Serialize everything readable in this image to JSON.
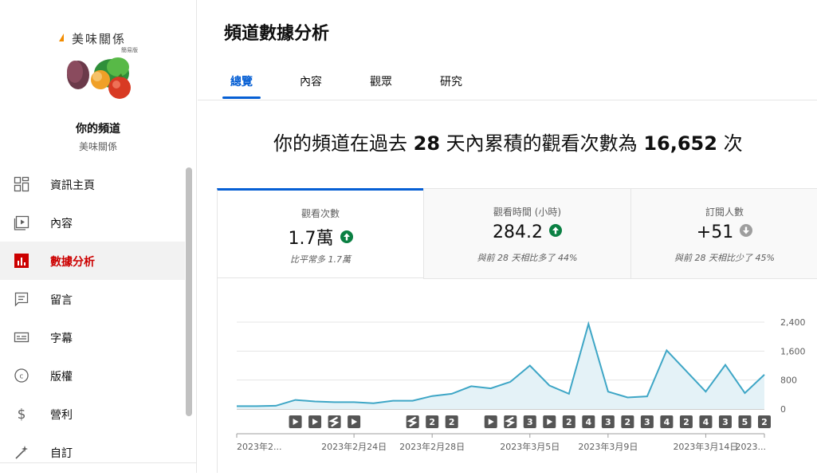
{
  "sidebar": {
    "logo_text": "美味關係",
    "logo_sub": "簡易版",
    "channel_title": "你的頻道",
    "channel_name": "美味關係",
    "items": [
      {
        "label": "資訊主頁",
        "icon": "dashboard-icon"
      },
      {
        "label": "內容",
        "icon": "content-icon"
      },
      {
        "label": "數據分析",
        "icon": "analytics-icon",
        "active": true
      },
      {
        "label": "留言",
        "icon": "comments-icon"
      },
      {
        "label": "字幕",
        "icon": "subtitles-icon"
      },
      {
        "label": "版權",
        "icon": "copyright-icon"
      },
      {
        "label": "營利",
        "icon": "monetization-icon"
      },
      {
        "label": "自訂",
        "icon": "customization-icon"
      }
    ]
  },
  "main": {
    "title": "頻道數據分析",
    "tabs": [
      {
        "label": "總覽",
        "active": true
      },
      {
        "label": "內容"
      },
      {
        "label": "觀眾"
      },
      {
        "label": "研究"
      }
    ],
    "headline": {
      "prefix": "你的頻道在過去 ",
      "days": "28",
      "middle": " 天內累積的觀看次數為 ",
      "views": "16,652",
      "suffix": " 次"
    },
    "cards": [
      {
        "label": "觀看次數",
        "value": "1.7萬",
        "trend": "up",
        "sub": "比平常多 1.7萬"
      },
      {
        "label": "觀看時間 (小時)",
        "value": "284.2",
        "trend": "up",
        "sub": "與前 28 天相比多了 44%"
      },
      {
        "label": "訂閱人數",
        "value": "+51",
        "trend": "down",
        "sub": "與前 28 天相比少了 45%"
      }
    ]
  },
  "colors": {
    "accent": "#065fd4",
    "active_nav": "#cc0000",
    "trend_up": "#0b8043",
    "trend_down": "#9e9e9e",
    "chart_line": "#3ea6c6",
    "chart_fill": "#e4f2f7"
  },
  "chart_data": {
    "type": "area",
    "x": [
      "2023-02-18",
      "2023-02-19",
      "2023-02-20",
      "2023-02-21",
      "2023-02-22",
      "2023-02-23",
      "2023-02-24",
      "2023-02-25",
      "2023-02-26",
      "2023-02-27",
      "2023-02-28",
      "2023-03-01",
      "2023-03-02",
      "2023-03-03",
      "2023-03-04",
      "2023-03-05",
      "2023-03-06",
      "2023-03-07",
      "2023-03-08",
      "2023-03-09",
      "2023-03-10",
      "2023-03-11",
      "2023-03-12",
      "2023-03-13",
      "2023-03-14",
      "2023-03-15",
      "2023-03-16",
      "2023-03-17"
    ],
    "values": [
      80,
      80,
      90,
      250,
      210,
      190,
      190,
      160,
      230,
      230,
      360,
      420,
      630,
      570,
      750,
      1200,
      650,
      420,
      2350,
      480,
      320,
      350,
      1620,
      1050,
      480,
      1220,
      440,
      950
    ],
    "y_ticks": [
      "2,400",
      "1,600",
      "800",
      "0"
    ],
    "ylim": [
      0,
      2400
    ],
    "x_tick_labels": [
      {
        "index": 0,
        "label": "2023年2..."
      },
      {
        "index": 6,
        "label": "2023年2月24日"
      },
      {
        "index": 10,
        "label": "2023年2月28日"
      },
      {
        "index": 15,
        "label": "2023年3月5日"
      },
      {
        "index": 19,
        "label": "2023年3月9日"
      },
      {
        "index": 24,
        "label": "2023年3月14日"
      },
      {
        "index": 27,
        "label": "2023..."
      }
    ],
    "grid": true,
    "markers": [
      {
        "index": 3,
        "kind": "play"
      },
      {
        "index": 4,
        "kind": "play"
      },
      {
        "index": 5,
        "kind": "short"
      },
      {
        "index": 6,
        "kind": "play"
      },
      {
        "index": 9,
        "kind": "short"
      },
      {
        "index": 10,
        "kind": "count",
        "text": "2"
      },
      {
        "index": 11,
        "kind": "count",
        "text": "2"
      },
      {
        "index": 13,
        "kind": "play"
      },
      {
        "index": 14,
        "kind": "short"
      },
      {
        "index": 15,
        "kind": "count",
        "text": "3"
      },
      {
        "index": 16,
        "kind": "play"
      },
      {
        "index": 17,
        "kind": "count",
        "text": "2"
      },
      {
        "index": 18,
        "kind": "count",
        "text": "4"
      },
      {
        "index": 19,
        "kind": "count",
        "text": "3"
      },
      {
        "index": 20,
        "kind": "count",
        "text": "2"
      },
      {
        "index": 21,
        "kind": "count",
        "text": "3"
      },
      {
        "index": 22,
        "kind": "count",
        "text": "4"
      },
      {
        "index": 23,
        "kind": "count",
        "text": "2"
      },
      {
        "index": 24,
        "kind": "count",
        "text": "4"
      },
      {
        "index": 25,
        "kind": "count",
        "text": "3"
      },
      {
        "index": 26,
        "kind": "count",
        "text": "5"
      },
      {
        "index": 27,
        "kind": "count",
        "text": "2"
      }
    ]
  }
}
